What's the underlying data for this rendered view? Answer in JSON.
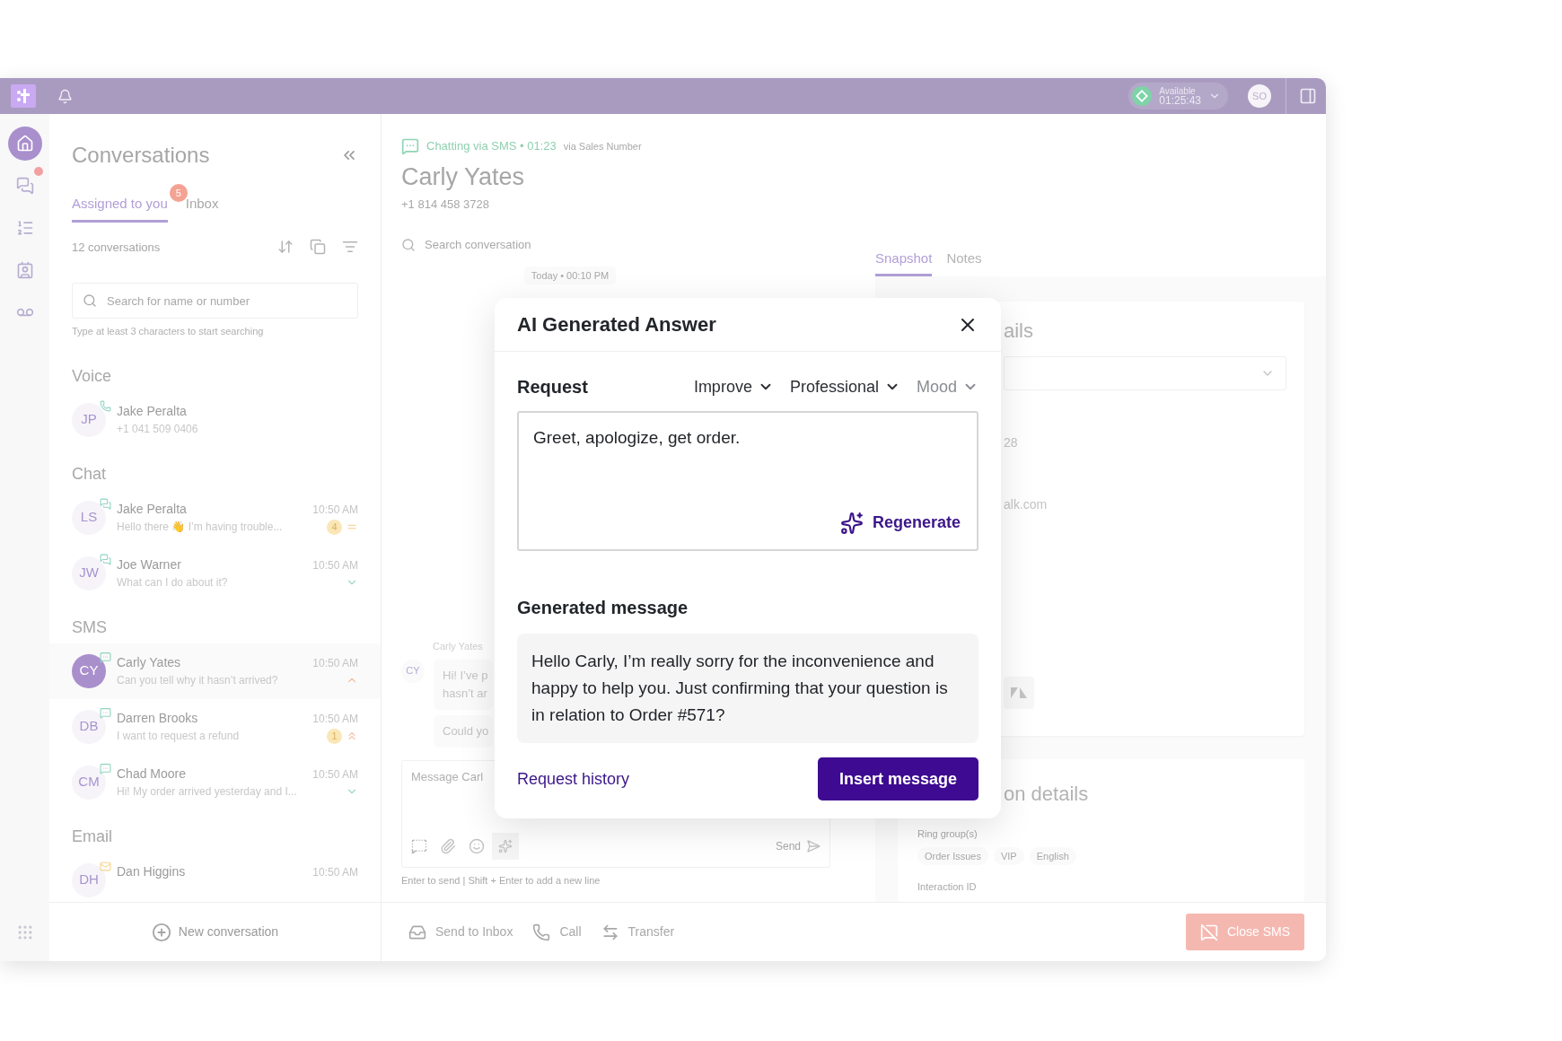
{
  "top_bar": {
    "status": {
      "label": "Available",
      "timer": "01:25:43",
      "online": true
    },
    "avatar": "SO"
  },
  "nav_rail": {
    "items": [
      {
        "kind": "home",
        "selected": true,
        "has_badge": false
      },
      {
        "kind": "conversations",
        "selected": false,
        "has_badge": true
      },
      {
        "kind": "tasks",
        "selected": false,
        "has_badge": false
      },
      {
        "kind": "contacts",
        "selected": false,
        "has_badge": false
      },
      {
        "kind": "voicemail",
        "selected": false,
        "has_badge": false
      }
    ]
  },
  "conversations": {
    "title": "Conversations",
    "tabs": [
      {
        "label": "Assigned to you",
        "selected": true,
        "badge": "5"
      },
      {
        "label": "Inbox",
        "selected": false
      }
    ],
    "count": "12 conversations",
    "search": {
      "placeholder": "Search for name or number",
      "hint": "Type at least 3 characters to start searching"
    },
    "groups": [
      {
        "title": "Voice",
        "items": [
          {
            "initials": "JP",
            "channel": {
              "kind": "voice"
            },
            "name": "Jake Peralta",
            "preview": "+1 041 509 0406",
            "selected": false
          }
        ]
      },
      {
        "title": "Chat",
        "items": [
          {
            "initials": "LS",
            "channel": {
              "kind": "chat"
            },
            "name": "Jake Peralta",
            "preview": "Hello there 👋 I’m having trouble...",
            "time": "10:50 AM",
            "unread": "4",
            "priority": {
              "kind": "medium"
            },
            "selected": false
          },
          {
            "initials": "JW",
            "channel": {
              "kind": "chat"
            },
            "name": "Joe Warner",
            "preview": "What can I do about it?",
            "time": "10:50 AM",
            "priority": {
              "kind": "low"
            },
            "selected": false
          }
        ]
      },
      {
        "title": "SMS",
        "items": [
          {
            "initials": "CY",
            "channel": {
              "kind": "sms"
            },
            "name": "Carly Yates",
            "preview": "Can you tell why it hasn’t arrived?",
            "time": "10:50 AM",
            "priority": {
              "kind": "high"
            },
            "selected": true
          },
          {
            "initials": "DB",
            "channel": {
              "kind": "sms"
            },
            "name": "Darren Brooks",
            "preview": "I want to request a refund",
            "time": "10:50 AM",
            "unread": "1",
            "priority": {
              "kind": "urgent"
            },
            "selected": false
          },
          {
            "initials": "CM",
            "channel": {
              "kind": "sms"
            },
            "name": "Chad Moore",
            "preview": "Hi! My order arrived yesterday and I...",
            "time": "10:50 AM",
            "priority": {
              "kind": "low"
            },
            "selected": false
          }
        ]
      },
      {
        "title": "Email",
        "items": [
          {
            "initials": "DH",
            "channel": {
              "kind": "email"
            },
            "name": "Dan Higgins",
            "time": "10:50 AM",
            "selected": false
          }
        ]
      }
    ],
    "new_button": "New conversation"
  },
  "chat": {
    "channel_status": "Chatting via SMS • 01:23",
    "via": "via Sales Number",
    "contact_name": "Carly Yates",
    "phone": "+1 814 458 3728",
    "search": {
      "placeholder": "Search conversation"
    },
    "date_chip": "Today • 00:10 PM",
    "sender": "Carly Yates",
    "avatar": "CY",
    "bubbles": [
      {
        "lines": [
          "Hi! I’ve p",
          "hasn’t ar"
        ]
      },
      {
        "lines": [
          "Could yo"
        ]
      }
    ],
    "composer": {
      "placeholder": "Message Carl",
      "send": "Send",
      "hint": "Enter to send | Shift + Enter to add a new line"
    }
  },
  "details": {
    "tabs": [
      {
        "label": "Snapshot",
        "selected": true
      },
      {
        "label": "Notes",
        "selected": false
      }
    ],
    "contact_card": {
      "title": "ails",
      "fields": [
        "28",
        "alk.com"
      ]
    },
    "interaction_card": {
      "title": "on details",
      "ring_groups_label": "Ring group(s)",
      "tags": [
        "Order Issues",
        "VIP",
        "English"
      ],
      "interaction_id_label": "Interaction ID"
    }
  },
  "actions": {
    "items": [
      {
        "kind": "inbox",
        "label": "Send to Inbox"
      },
      {
        "kind": "call",
        "label": "Call"
      },
      {
        "kind": "transfer",
        "label": "Transfer"
      }
    ],
    "close": "Close SMS"
  },
  "modal": {
    "title": "AI Generated Answer",
    "request_label": "Request",
    "options": [
      {
        "label": "Improve",
        "set": true
      },
      {
        "label": "Professional",
        "set": true
      },
      {
        "label": "Mood",
        "set": false
      }
    ],
    "request_text": "Greet, apologize, get order.",
    "regenerate": "Regenerate",
    "generated_label": "Generated message",
    "generated_text": "Hello Carly, I’m really sorry for the inconvenience and happy to help you. Just confirming that your question is in relation to Order #571?",
    "history_link": "Request history",
    "insert_button": "Insert message"
  }
}
